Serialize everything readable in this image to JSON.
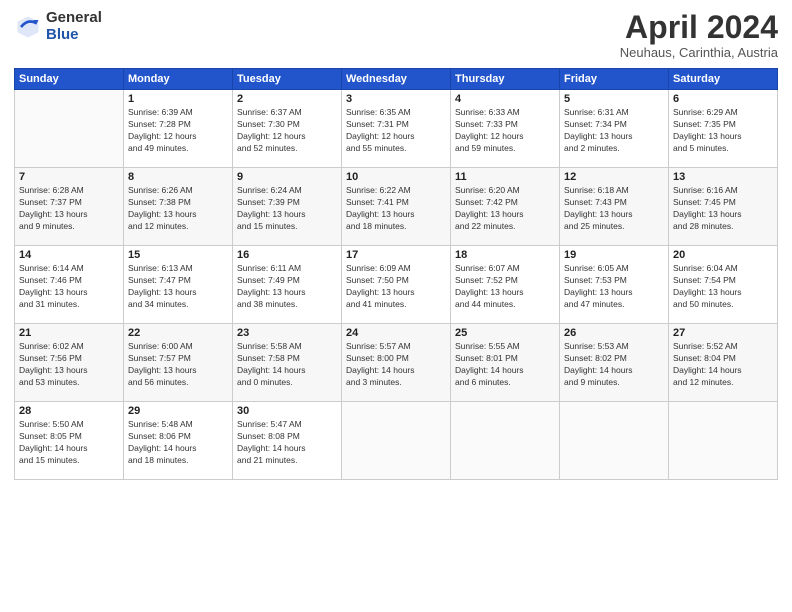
{
  "logo": {
    "general": "General",
    "blue": "Blue"
  },
  "header": {
    "month": "April 2024",
    "location": "Neuhaus, Carinthia, Austria"
  },
  "weekdays": [
    "Sunday",
    "Monday",
    "Tuesday",
    "Wednesday",
    "Thursday",
    "Friday",
    "Saturday"
  ],
  "weeks": [
    [
      {
        "day": "",
        "text": ""
      },
      {
        "day": "1",
        "text": "Sunrise: 6:39 AM\nSunset: 7:28 PM\nDaylight: 12 hours\nand 49 minutes."
      },
      {
        "day": "2",
        "text": "Sunrise: 6:37 AM\nSunset: 7:30 PM\nDaylight: 12 hours\nand 52 minutes."
      },
      {
        "day": "3",
        "text": "Sunrise: 6:35 AM\nSunset: 7:31 PM\nDaylight: 12 hours\nand 55 minutes."
      },
      {
        "day": "4",
        "text": "Sunrise: 6:33 AM\nSunset: 7:33 PM\nDaylight: 12 hours\nand 59 minutes."
      },
      {
        "day": "5",
        "text": "Sunrise: 6:31 AM\nSunset: 7:34 PM\nDaylight: 13 hours\nand 2 minutes."
      },
      {
        "day": "6",
        "text": "Sunrise: 6:29 AM\nSunset: 7:35 PM\nDaylight: 13 hours\nand 5 minutes."
      }
    ],
    [
      {
        "day": "7",
        "text": "Sunrise: 6:28 AM\nSunset: 7:37 PM\nDaylight: 13 hours\nand 9 minutes."
      },
      {
        "day": "8",
        "text": "Sunrise: 6:26 AM\nSunset: 7:38 PM\nDaylight: 13 hours\nand 12 minutes."
      },
      {
        "day": "9",
        "text": "Sunrise: 6:24 AM\nSunset: 7:39 PM\nDaylight: 13 hours\nand 15 minutes."
      },
      {
        "day": "10",
        "text": "Sunrise: 6:22 AM\nSunset: 7:41 PM\nDaylight: 13 hours\nand 18 minutes."
      },
      {
        "day": "11",
        "text": "Sunrise: 6:20 AM\nSunset: 7:42 PM\nDaylight: 13 hours\nand 22 minutes."
      },
      {
        "day": "12",
        "text": "Sunrise: 6:18 AM\nSunset: 7:43 PM\nDaylight: 13 hours\nand 25 minutes."
      },
      {
        "day": "13",
        "text": "Sunrise: 6:16 AM\nSunset: 7:45 PM\nDaylight: 13 hours\nand 28 minutes."
      }
    ],
    [
      {
        "day": "14",
        "text": "Sunrise: 6:14 AM\nSunset: 7:46 PM\nDaylight: 13 hours\nand 31 minutes."
      },
      {
        "day": "15",
        "text": "Sunrise: 6:13 AM\nSunset: 7:47 PM\nDaylight: 13 hours\nand 34 minutes."
      },
      {
        "day": "16",
        "text": "Sunrise: 6:11 AM\nSunset: 7:49 PM\nDaylight: 13 hours\nand 38 minutes."
      },
      {
        "day": "17",
        "text": "Sunrise: 6:09 AM\nSunset: 7:50 PM\nDaylight: 13 hours\nand 41 minutes."
      },
      {
        "day": "18",
        "text": "Sunrise: 6:07 AM\nSunset: 7:52 PM\nDaylight: 13 hours\nand 44 minutes."
      },
      {
        "day": "19",
        "text": "Sunrise: 6:05 AM\nSunset: 7:53 PM\nDaylight: 13 hours\nand 47 minutes."
      },
      {
        "day": "20",
        "text": "Sunrise: 6:04 AM\nSunset: 7:54 PM\nDaylight: 13 hours\nand 50 minutes."
      }
    ],
    [
      {
        "day": "21",
        "text": "Sunrise: 6:02 AM\nSunset: 7:56 PM\nDaylight: 13 hours\nand 53 minutes."
      },
      {
        "day": "22",
        "text": "Sunrise: 6:00 AM\nSunset: 7:57 PM\nDaylight: 13 hours\nand 56 minutes."
      },
      {
        "day": "23",
        "text": "Sunrise: 5:58 AM\nSunset: 7:58 PM\nDaylight: 14 hours\nand 0 minutes."
      },
      {
        "day": "24",
        "text": "Sunrise: 5:57 AM\nSunset: 8:00 PM\nDaylight: 14 hours\nand 3 minutes."
      },
      {
        "day": "25",
        "text": "Sunrise: 5:55 AM\nSunset: 8:01 PM\nDaylight: 14 hours\nand 6 minutes."
      },
      {
        "day": "26",
        "text": "Sunrise: 5:53 AM\nSunset: 8:02 PM\nDaylight: 14 hours\nand 9 minutes."
      },
      {
        "day": "27",
        "text": "Sunrise: 5:52 AM\nSunset: 8:04 PM\nDaylight: 14 hours\nand 12 minutes."
      }
    ],
    [
      {
        "day": "28",
        "text": "Sunrise: 5:50 AM\nSunset: 8:05 PM\nDaylight: 14 hours\nand 15 minutes."
      },
      {
        "day": "29",
        "text": "Sunrise: 5:48 AM\nSunset: 8:06 PM\nDaylight: 14 hours\nand 18 minutes."
      },
      {
        "day": "30",
        "text": "Sunrise: 5:47 AM\nSunset: 8:08 PM\nDaylight: 14 hours\nand 21 minutes."
      },
      {
        "day": "",
        "text": ""
      },
      {
        "day": "",
        "text": ""
      },
      {
        "day": "",
        "text": ""
      },
      {
        "day": "",
        "text": ""
      }
    ]
  ]
}
